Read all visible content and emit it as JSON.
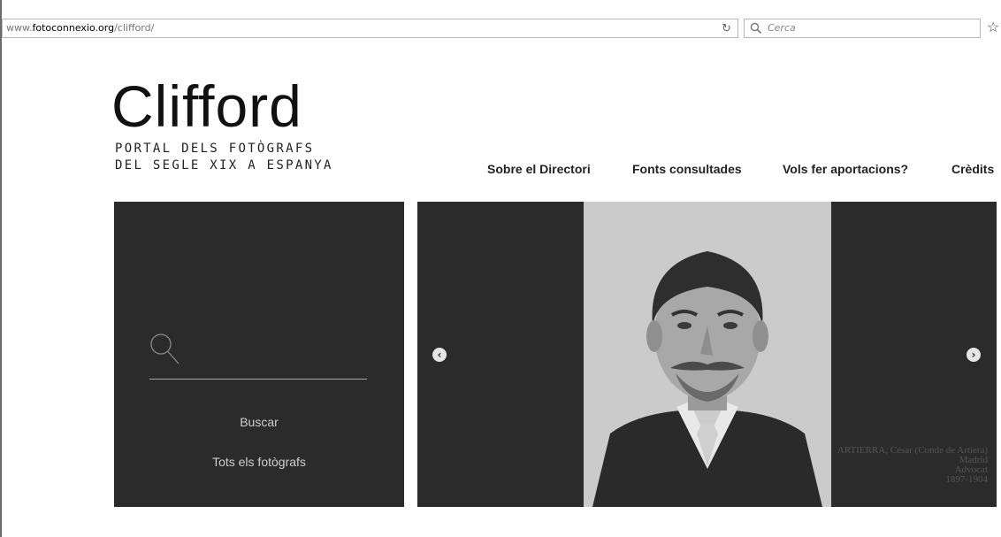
{
  "browser": {
    "url_prefix": "www.",
    "url_host": "fotoconnexio.org",
    "url_path": "/clifford/",
    "search_placeholder": "Cerca",
    "reload_icon": "reload-icon",
    "bookmark_icon": "star-icon"
  },
  "logo": {
    "title": "Clifford",
    "subtitle_line1": "PORTAL DELS FOTÒGRAFS",
    "subtitle_line2": "DEL SEGLE XIX A ESPANYA"
  },
  "nav": {
    "items": [
      {
        "label": "Sobre el Directori"
      },
      {
        "label": "Fonts consultades"
      },
      {
        "label": "Vols fer aportacions?"
      },
      {
        "label": "Crèdits"
      }
    ]
  },
  "search_panel": {
    "search_label": "Buscar",
    "all_label": "Tots els fotògrafs",
    "icon": "search-icon"
  },
  "slider": {
    "caption_line1": "ARTIERRA, César (Conde de Artiera)",
    "caption_line2": "Madrid",
    "caption_line3": "Advocat",
    "caption_line4": "1897-1904",
    "prev_icon": "chevron-left-icon",
    "next_icon": "chevron-right-icon"
  },
  "colors": {
    "panel_bg": "#2b2b2b",
    "nav_text": "#222222",
    "panel_text": "#cfcfcf"
  }
}
